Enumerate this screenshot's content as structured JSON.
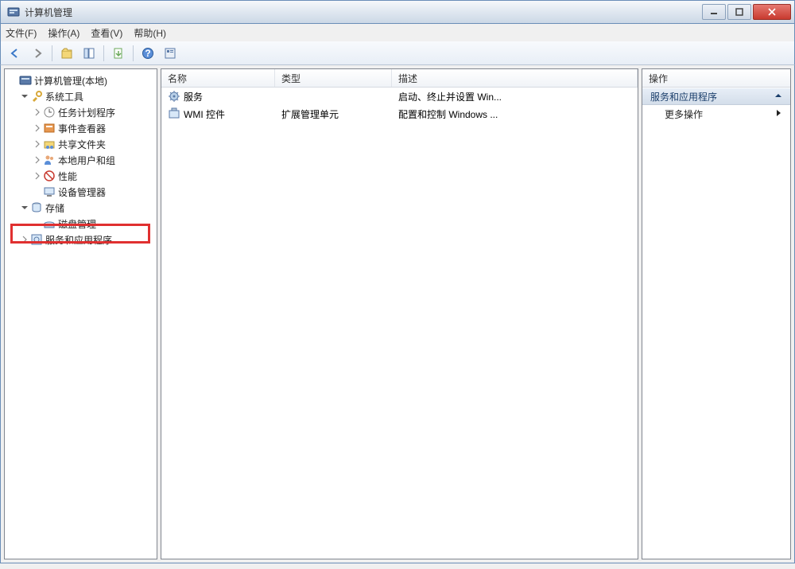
{
  "window": {
    "title": "计算机管理"
  },
  "menu": {
    "file": "文件(F)",
    "action": "操作(A)",
    "view": "查看(V)",
    "help": "帮助(H)"
  },
  "tree": {
    "root": "计算机管理(本地)",
    "system_tools": "系统工具",
    "task_scheduler": "任务计划程序",
    "event_viewer": "事件查看器",
    "shared_folders": "共享文件夹",
    "local_users": "本地用户和组",
    "performance": "性能",
    "device_manager": "设备管理器",
    "storage": "存储",
    "disk_management": "磁盘管理",
    "services_apps": "服务和应用程序"
  },
  "list": {
    "columns": {
      "name": "名称",
      "type": "类型",
      "desc": "描述"
    },
    "rows": [
      {
        "name": "服务",
        "type": "",
        "desc": "启动、终止并设置 Win..."
      },
      {
        "name": "WMI 控件",
        "type": "扩展管理单元",
        "desc": "配置和控制 Windows ..."
      }
    ]
  },
  "actions": {
    "header": "操作",
    "section": "服务和应用程序",
    "more": "更多操作"
  }
}
